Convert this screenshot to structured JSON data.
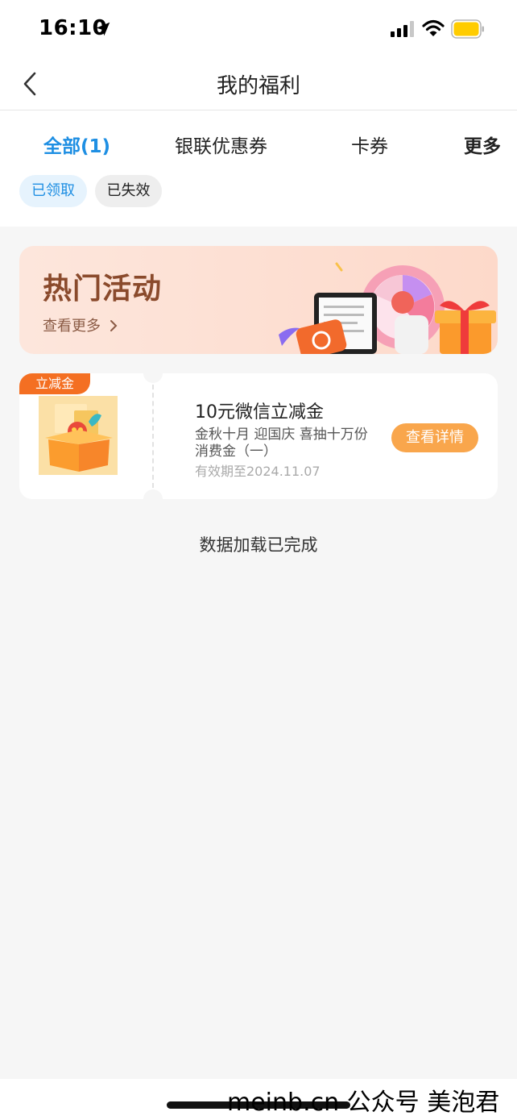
{
  "status": {
    "time": "16:10"
  },
  "nav": {
    "title": "我的福利"
  },
  "tabs": [
    {
      "label": "全部(1)",
      "active": true
    },
    {
      "label": "银联优惠券",
      "active": false
    },
    {
      "label": "卡券",
      "active": false
    },
    {
      "label": "更多",
      "active": false
    }
  ],
  "filters": [
    {
      "label": "已领取",
      "active": true
    },
    {
      "label": "已失效",
      "active": false
    }
  ],
  "banner": {
    "title": "热门活动",
    "more_label": "查看更多"
  },
  "coupon": {
    "badge": "立减金",
    "title": "10元微信立减金",
    "description": "金秋十月 迎国庆 喜抽十万份消费金（一）",
    "expiry": "有效期至2024.11.07",
    "button_label": "查看详情"
  },
  "footer": {
    "loaded_text": "数据加载已完成"
  },
  "watermark": "meinb.cn 公众号 美泡君",
  "colors": {
    "accent": "#1f8fe3",
    "button": "#f9a64c",
    "badge": "#f46f22"
  }
}
